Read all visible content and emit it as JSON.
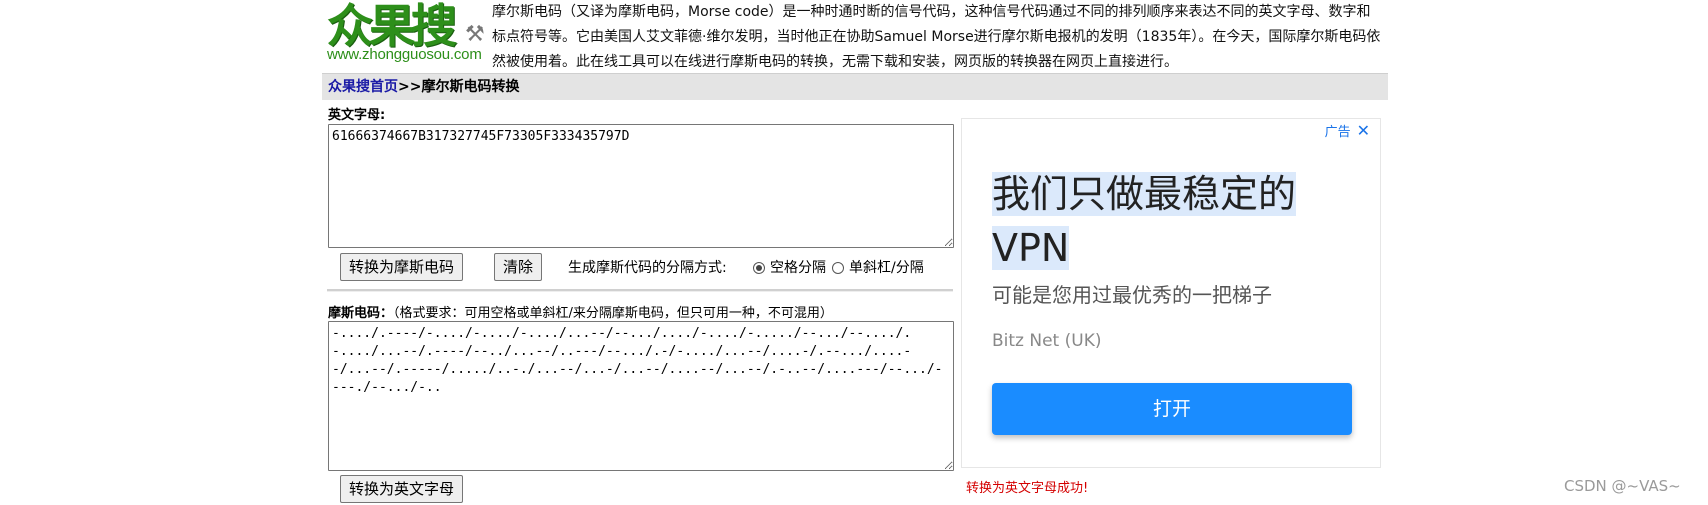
{
  "header": {
    "logo_text": "众果搜",
    "logo_url": "www.zhongguosou.com",
    "intro": "摩尔斯电码（又译为摩斯电码，Morse code）是一种时通时断的信号代码，这种信号代码通过不同的排列顺序来表达不同的英文字母、数字和标点符号等。它由美国人艾文菲德·维尔发明，当时他正在协助Samuel Morse进行摩尔斯电报机的发明（1835年）。在今天，国际摩尔斯电码依然被使用着。此在线工具可以在线进行摩斯电码的转换，无需下载和安装，网页版的转换器在网页上直接进行。"
  },
  "breadcrumb": {
    "home": "众果搜首页",
    "separator": ">>",
    "current": "摩尔斯电码转换"
  },
  "english": {
    "label": "英文字母",
    "value": "61666374667B317327745F73305F333435797D"
  },
  "controls": {
    "to_morse": "转换为摩斯电码",
    "clear": "清除",
    "sep_label": "生成摩斯代码的分隔方式:",
    "option_space": "空格分隔",
    "option_slash": "单斜杠/分隔",
    "selected": "space"
  },
  "morse": {
    "label": "摩斯电码",
    "hint": "（格式要求：可用空格或单斜杠/来分隔摩斯电码，但只可用一种，不可混用）",
    "value": "-..../.----/-..../-..../-..../...--/--.../..../-..../-...../--.../--..../.-..../...--/.----/--../...--/..---/--.../.-/-..../...--/....-/.--.../....--/...--/.-----/...../..-./...--/...-/...--/....--/...--/.-..--/....---/--.../----./--.../-.."
  },
  "to_english": "转换为英文字母",
  "status": "转换为英文字母成功!",
  "ad": {
    "tag": "广告",
    "headline_line1": "我们只做最稳定的",
    "headline_line2": "VPN",
    "sub": "可能是您用过最优秀的一把梯子",
    "source": "Bitz Net (UK)",
    "button": "打开"
  },
  "watermark": "CSDN @~VAS~"
}
